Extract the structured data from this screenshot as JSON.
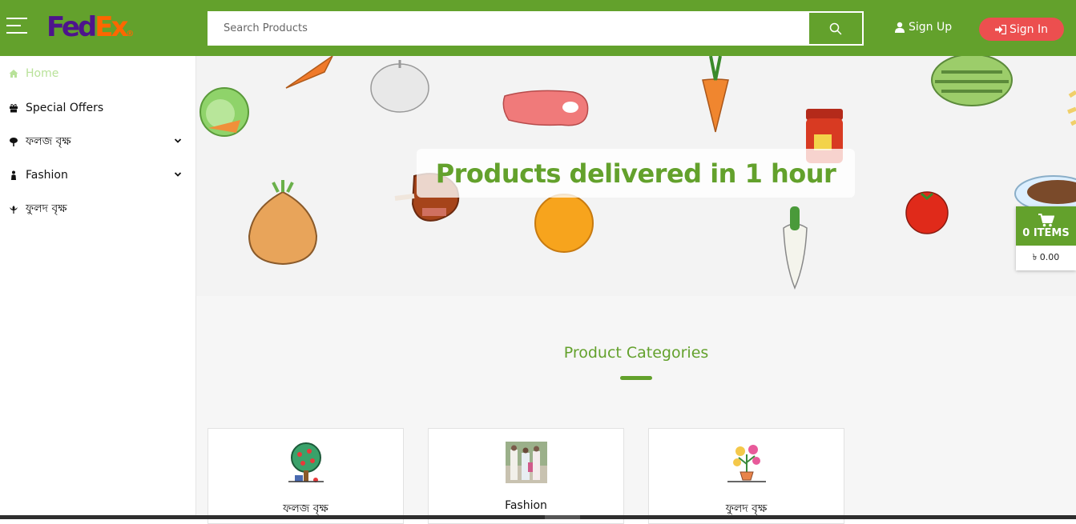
{
  "header": {
    "menu_icon": "hamburger-icon",
    "logo": {
      "fed": "Fed",
      "ex": "Ex",
      "dot": "®",
      "colors": {
        "fed": "#4d148c",
        "ex": "#ff6600"
      }
    },
    "search": {
      "placeholder": "Search Products",
      "value": "",
      "button_icon": "search-icon"
    },
    "signup_label": "Sign Up",
    "signin_label": "Sign In",
    "brand_color": "#63a12c",
    "signin_color": "#ec4f4f"
  },
  "sidebar": {
    "items": [
      {
        "label": "Home",
        "icon": "home-icon",
        "active": true,
        "expandable": false
      },
      {
        "label": "Special Offers",
        "icon": "gift-icon",
        "active": false,
        "expandable": false
      },
      {
        "label": "ফলজ বৃক্ষ",
        "icon": "tree-icon",
        "active": false,
        "expandable": true
      },
      {
        "label": "Fashion",
        "icon": "person-icon",
        "active": false,
        "expandable": true
      },
      {
        "label": "ফুলদ বৃক্ষ",
        "icon": "flower-icon",
        "active": false,
        "expandable": false
      }
    ]
  },
  "hero": {
    "title": "Products delivered in 1 hour",
    "illustrations": [
      "cabbage-icon",
      "carrot-icon",
      "garlic-icon",
      "steak-icon",
      "carrot-icon",
      "jam-jar-icon",
      "watermelon-icon",
      "onion-icon",
      "chicken-leg-icon",
      "orange-icon",
      "radish-icon",
      "tomato-icon",
      "coffee-cup-icon"
    ]
  },
  "categories": {
    "title": "Product Categories",
    "items": [
      {
        "name": "ফলজ বৃক্ষ",
        "icon": "fruit-tree-icon"
      },
      {
        "name": "Fashion",
        "icon": "fashion-photo"
      },
      {
        "name": "ফুলদ বৃক্ষ",
        "icon": "flower-pot-icon"
      }
    ]
  },
  "cart": {
    "icon": "cart-icon",
    "items_label": "0 ITEMS",
    "total": "৳ 0.00"
  }
}
